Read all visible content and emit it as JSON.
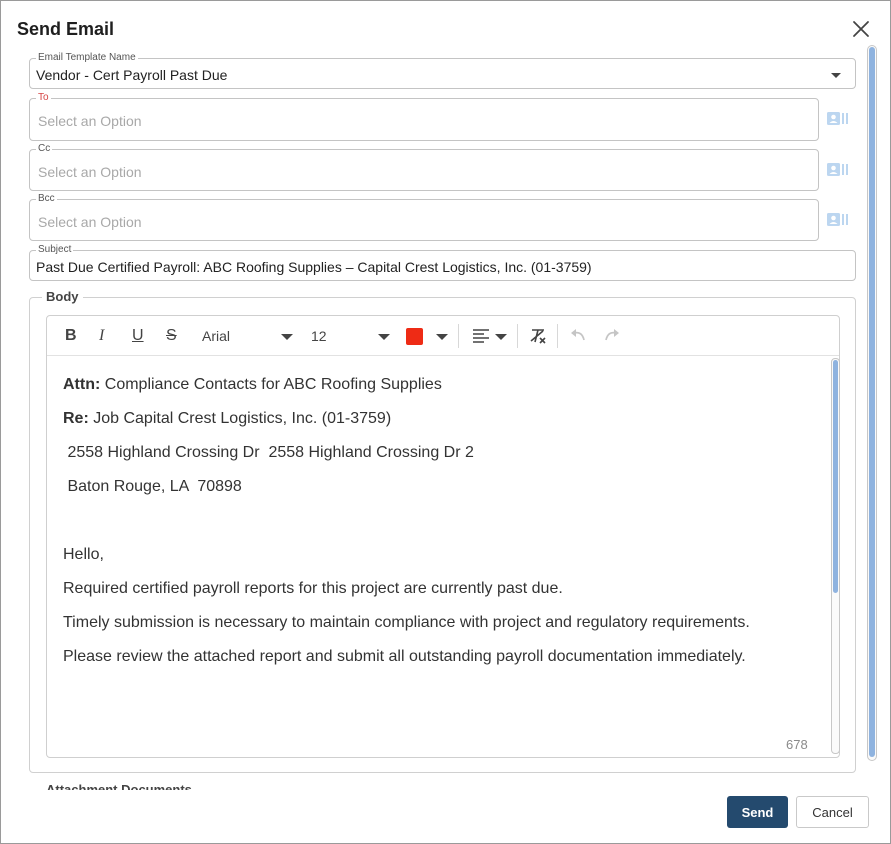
{
  "dialog": {
    "title": "Send Email"
  },
  "template": {
    "label": "Email Template Name",
    "value": "Vendor - Cert Payroll Past Due"
  },
  "to": {
    "label": "To",
    "placeholder": "Select an Option"
  },
  "cc": {
    "label": "Cc",
    "placeholder": "Select an Option"
  },
  "bcc": {
    "label": "Bcc",
    "placeholder": "Select an Option"
  },
  "subject": {
    "label": "Subject",
    "value": "Past Due Certified Payroll: ABC Roofing Supplies – Capital Crest Logistics, Inc. (01-3759)"
  },
  "body": {
    "label": "Body",
    "toolbar": {
      "bold": "B",
      "italic": "I",
      "underline": "U",
      "strike": "S",
      "font": "Arial",
      "size": "12",
      "text_color": "#ee2b15"
    },
    "lines": {
      "attn_label": "Attn:",
      "attn_text": " Compliance Contacts for  ABC Roofing Supplies",
      "re_label": "Re:",
      "re_text": " Job Capital Crest Logistics, Inc. (01-3759)",
      "address1": " 2558 Highland Crossing Dr  2558 Highland Crossing Dr 2",
      "address2": " Baton Rouge, LA  70898",
      "greeting": "Hello,",
      "p1": "Required certified payroll reports for this project are currently past due.",
      "p2": "Timely submission is necessary to maintain compliance with project and regulatory requirements.",
      "p3": "Please review the attached report and submit all outstanding payroll documentation immediately."
    },
    "char_count": "678"
  },
  "attachments": {
    "label": "Attachment Documents"
  },
  "actions": {
    "send": "Send",
    "cancel": "Cancel"
  },
  "colors": {
    "primary": "#244a6e",
    "scroll_thumb": "#8fb3df",
    "required": "#d64545"
  }
}
